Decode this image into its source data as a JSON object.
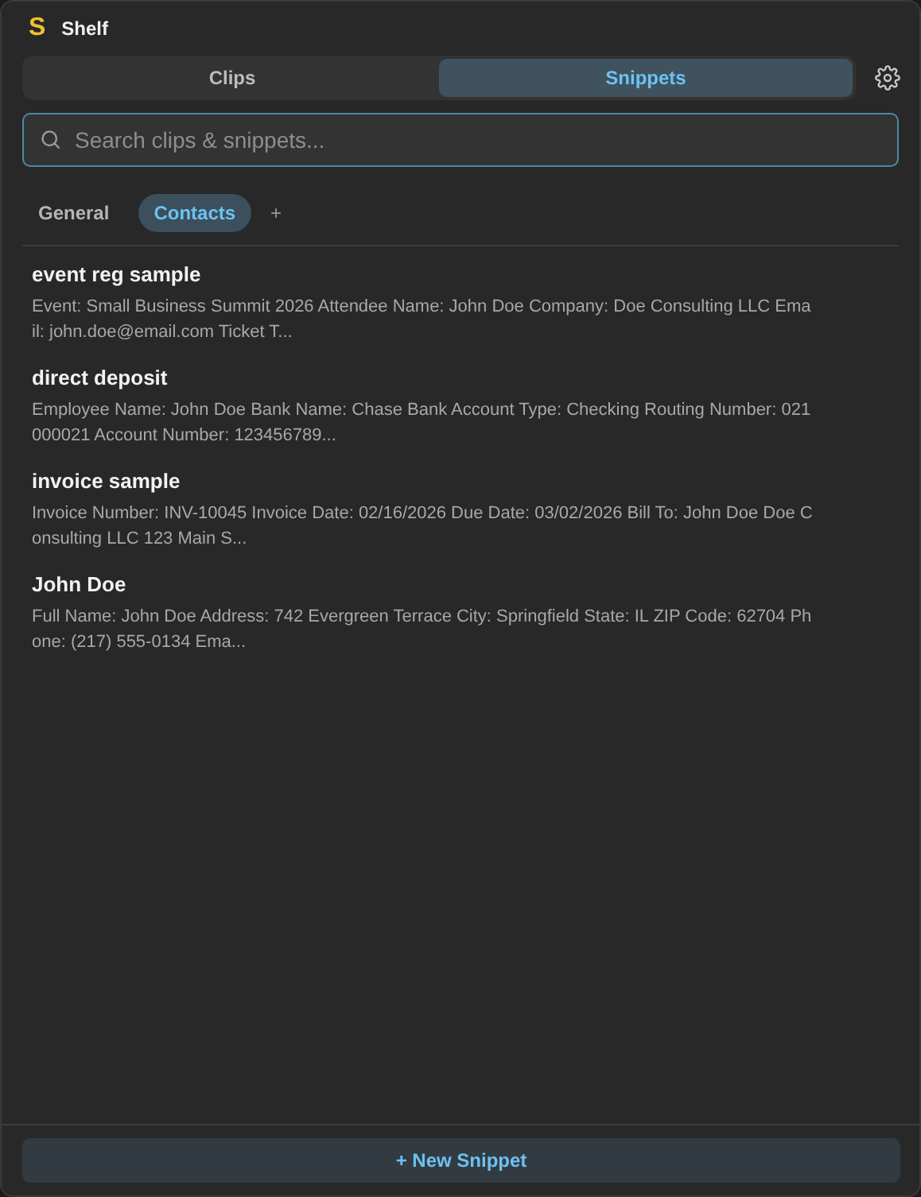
{
  "window": {
    "logo": "S",
    "title": "Shelf"
  },
  "tabs": [
    {
      "label": "Clips",
      "selected": false
    },
    {
      "label": "Snippets",
      "selected": true
    }
  ],
  "search": {
    "placeholder": "Search clips & snippets..."
  },
  "categories": [
    {
      "label": "General",
      "selected": false
    },
    {
      "label": "Contacts",
      "selected": true
    }
  ],
  "add_category": "+",
  "snippets": [
    {
      "title": "event reg sample",
      "preview": "Event: Small Business Summit 2026 Attendee Name: John Doe Company: Doe Consulting LLC Email: john.doe@email.com Ticket T..."
    },
    {
      "title": "direct deposit",
      "preview": "Employee Name: John Doe Bank Name: Chase Bank Account Type: Checking Routing Number: 021000021 Account Number: 123456789..."
    },
    {
      "title": "invoice sample",
      "preview": "Invoice Number: INV-10045 Invoice Date: 02/16/2026 Due Date: 03/02/2026 Bill To: John Doe Doe Consulting LLC 123 Main S..."
    },
    {
      "title": "John Doe",
      "preview": "Full Name: John Doe Address: 742 Evergreen Terrace City: Springfield State: IL ZIP Code: 62704 Phone: (217) 555-0134 Ema..."
    }
  ],
  "new_button": "+ New Snippet"
}
